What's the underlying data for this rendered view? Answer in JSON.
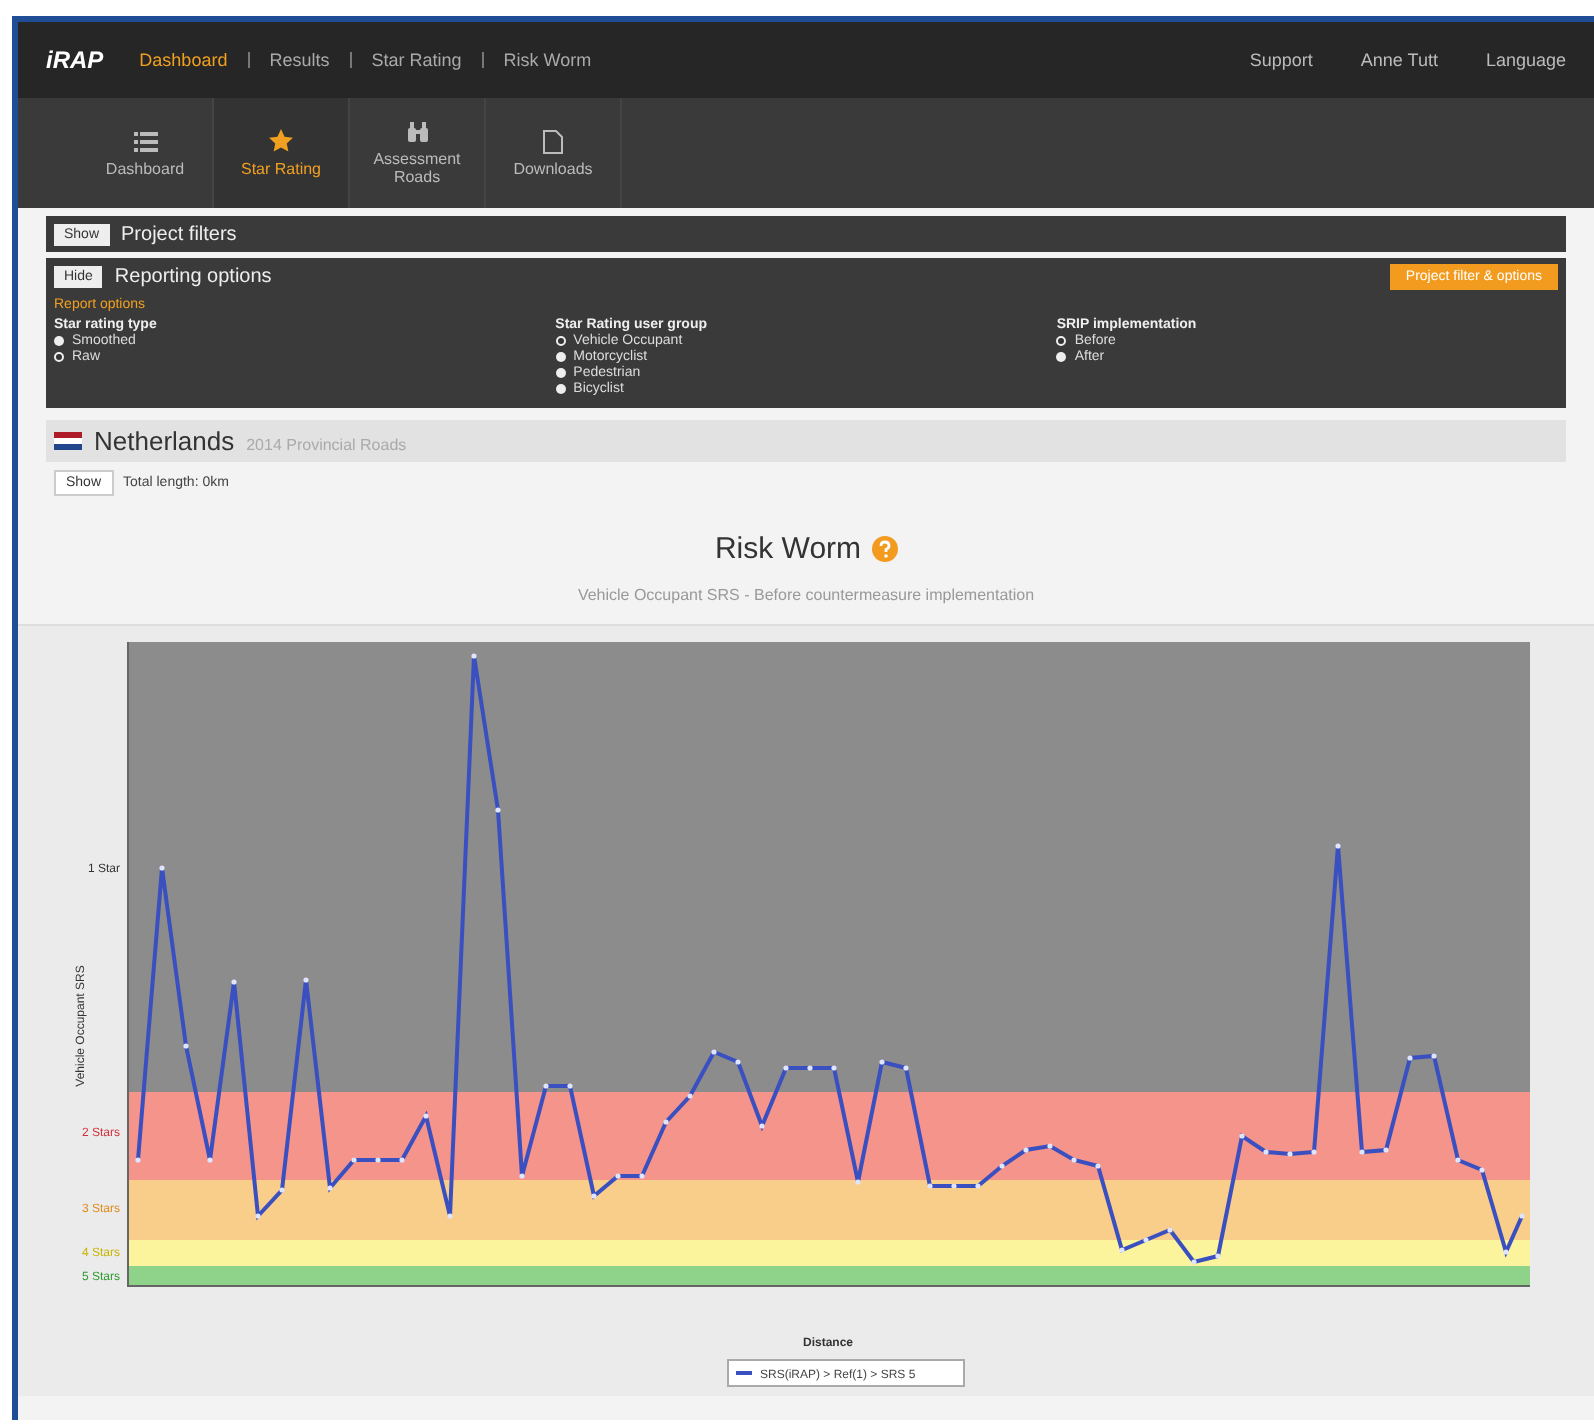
{
  "header": {
    "logo": "iRAP",
    "breadcrumb": [
      {
        "label": "Dashboard",
        "selected": true
      },
      {
        "label": "Results",
        "selected": false
      },
      {
        "label": "Star Rating",
        "selected": false
      },
      {
        "label": "Risk Worm",
        "selected": false
      }
    ],
    "links": [
      "Support",
      "Anne Tutt",
      "Language"
    ]
  },
  "tabs": [
    {
      "label": "Dashboard",
      "selected": false
    },
    {
      "label": "Star Rating",
      "selected": true
    },
    {
      "label": "Assessment Roads",
      "selected": false
    },
    {
      "label": "Downloads",
      "selected": false
    }
  ],
  "project_filters": {
    "toggle": "Show",
    "title": "Project filters"
  },
  "reporting_options": {
    "toggle": "Hide",
    "title": "Reporting options",
    "action": "Project filter & options",
    "section": "Report options",
    "groups": [
      {
        "title": "Star rating type",
        "options": [
          {
            "label": "Smoothed",
            "selected": false
          },
          {
            "label": "Raw",
            "selected": true
          }
        ]
      },
      {
        "title": "Star Rating user group",
        "options": [
          {
            "label": "Vehicle Occupant",
            "selected": true
          },
          {
            "label": "Motorcyclist",
            "selected": false
          },
          {
            "label": "Pedestrian",
            "selected": false
          },
          {
            "label": "Bicyclist",
            "selected": false
          }
        ]
      },
      {
        "title": "SRIP implementation",
        "options": [
          {
            "label": "Before",
            "selected": true
          },
          {
            "label": "After",
            "selected": false
          }
        ]
      }
    ]
  },
  "network": {
    "country": "Netherlands",
    "subtitle": "2014 Provincial Roads",
    "toggle": "Show",
    "length": "Total length: 0km"
  },
  "chart": {
    "title": "Risk Worm",
    "subtitle": "Vehicle Occupant SRS - Before countermeasure implementation",
    "ylabel": "Vehicle Occupant SRS",
    "xlabel": "Distance",
    "legend": "SRS(iRAP) > Ref(1) > SRS 5",
    "bands": [
      {
        "label": "1 Star",
        "color": "#8c8c8c"
      },
      {
        "label": "2 Stars",
        "color": "#f4948a"
      },
      {
        "label": "3 Stars",
        "color": "#f9cd8a"
      },
      {
        "label": "4 Stars",
        "color": "#fbf49c"
      },
      {
        "label": "5 Stars",
        "color": "#8fd28a"
      }
    ]
  }
}
